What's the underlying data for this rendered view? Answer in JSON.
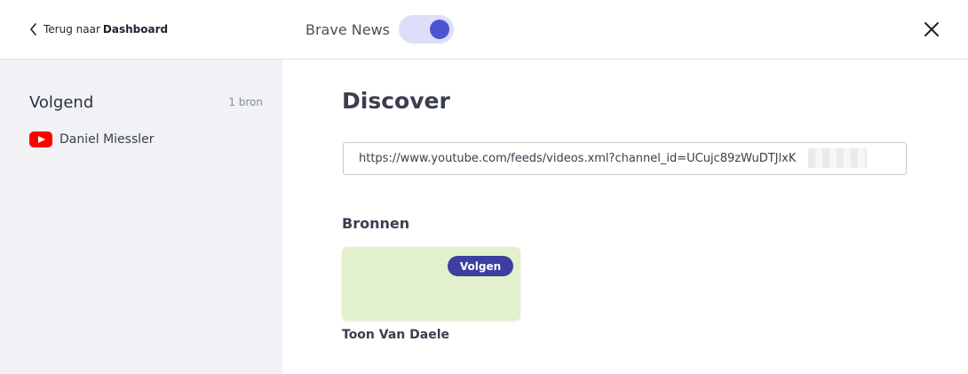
{
  "header": {
    "back_prefix": "Terug naar",
    "back_target": "Dashboard",
    "toggle_label": "Brave News",
    "toggle_on": true,
    "close_icon": "close-icon"
  },
  "sidebar": {
    "title": "Volgend",
    "count": "1 bron",
    "items": [
      {
        "label": "Daniel Miessler",
        "icon": "youtube-icon"
      }
    ]
  },
  "main": {
    "title": "Discover",
    "url_value": "https://www.youtube.com/feeds/videos.xml?channel_id=UCujc89zWuDTJlxK",
    "sources_heading": "Bronnen",
    "sources": [
      {
        "name": "Toon Van Daele",
        "button_label": "Volgen",
        "card_color": "#e2f0cd"
      }
    ]
  },
  "colors": {
    "accent": "#4c54d2",
    "button": "#3d3fa1",
    "sidebar_bg": "#f1f2f5",
    "youtube_red": "#ff0000"
  }
}
